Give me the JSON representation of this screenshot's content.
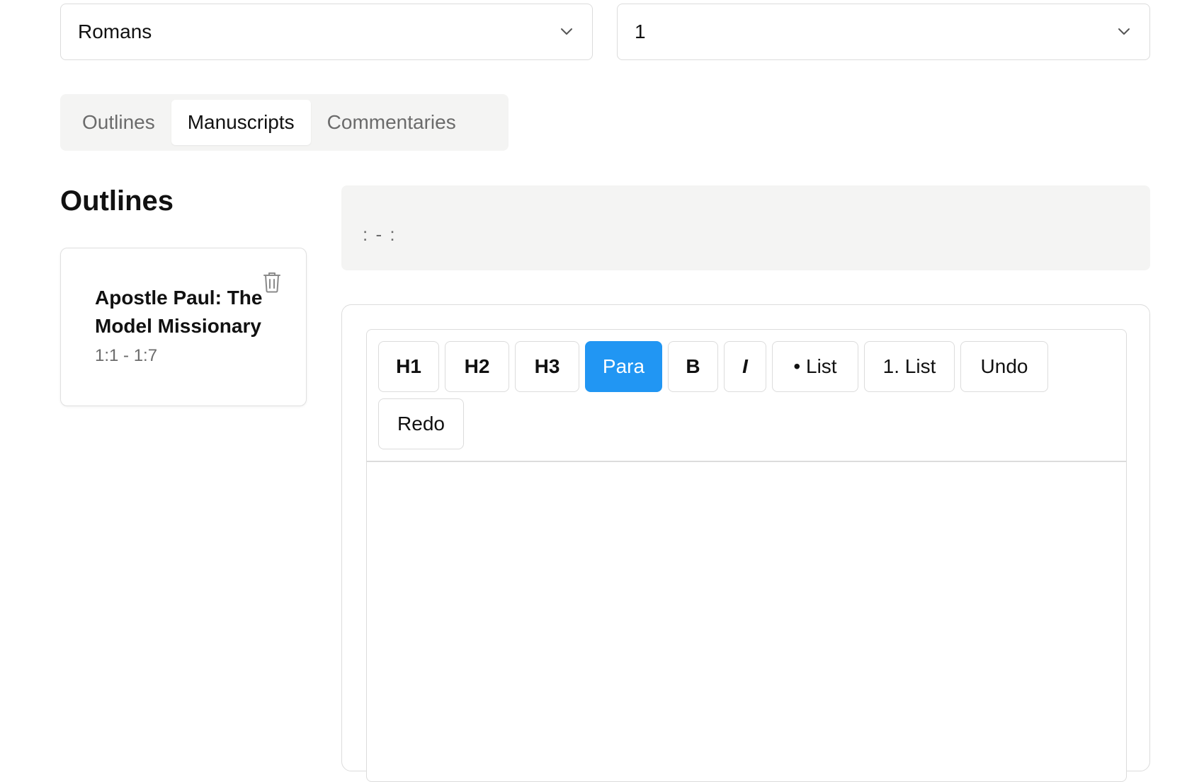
{
  "selectors": {
    "book": {
      "value": "Romans"
    },
    "chapter": {
      "value": "1"
    }
  },
  "tabs": [
    {
      "label": "Outlines",
      "active": false
    },
    {
      "label": "Manuscripts",
      "active": true
    },
    {
      "label": "Commentaries",
      "active": false
    }
  ],
  "sidebar": {
    "heading": "Outlines",
    "cards": [
      {
        "title": "Apostle Paul: The Model Missionary",
        "range": "1:1 - 1:7"
      }
    ]
  },
  "reference": {
    "text": ": - :"
  },
  "toolbar": {
    "buttons": [
      {
        "label": "H1",
        "active": false
      },
      {
        "label": "H2",
        "active": false
      },
      {
        "label": "H3",
        "active": false
      },
      {
        "label": "Para",
        "active": true
      },
      {
        "label": "B",
        "active": false
      },
      {
        "label": "I",
        "active": false
      },
      {
        "label": "• List",
        "active": false
      },
      {
        "label": "1. List",
        "active": false
      },
      {
        "label": "Undo",
        "active": false
      },
      {
        "label": "Redo",
        "active": false
      }
    ]
  },
  "colors": {
    "accent": "#2196f3",
    "muted_bg": "#f4f4f3",
    "border": "#dcdcdc",
    "muted_text": "#6b6b6b"
  },
  "icons": {
    "select_chevron": "chevron-down-icon",
    "card_delete": "trash-icon"
  }
}
